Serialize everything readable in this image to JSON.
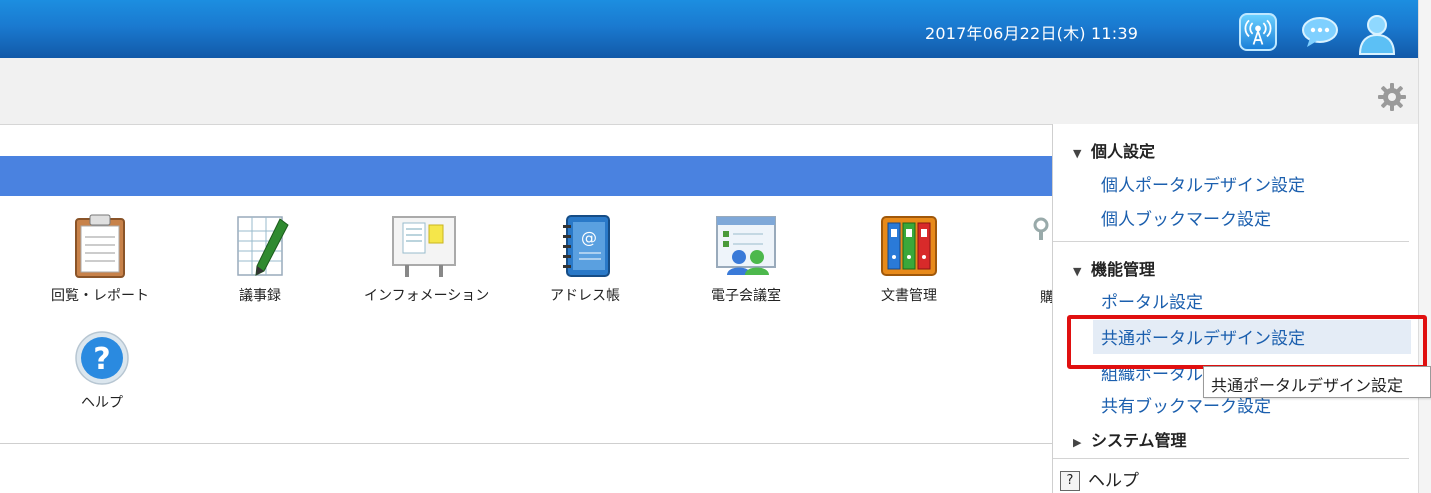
{
  "header": {
    "datetime": "2017年06月22日(木) 11:39",
    "icons": [
      "broadcast-icon",
      "chat-icon",
      "user-icon"
    ]
  },
  "toolbar": {
    "settings_icon": "gear-icon"
  },
  "apps": [
    {
      "label": "回覧・レポート",
      "icon": "clipboard-icon"
    },
    {
      "label": "議事録",
      "icon": "minutes-icon"
    },
    {
      "label": "インフォメーション",
      "icon": "bulletin-board-icon"
    },
    {
      "label": "アドレス帳",
      "icon": "address-book-icon"
    },
    {
      "label": "電子会議室",
      "icon": "conference-room-icon"
    },
    {
      "label": "文書管理",
      "icon": "binders-icon"
    },
    {
      "label": "ヘルプ",
      "icon": "help-icon"
    }
  ],
  "partial_label": "購",
  "menu": {
    "personal": {
      "title": "個人設定",
      "items": [
        "個人ポータルデザイン設定",
        "個人ブックマーク設定"
      ]
    },
    "function": {
      "title": "機能管理",
      "items": [
        "ポータル設定",
        "共通ポータルデザイン設定",
        "組織ポータル",
        "共有ブックマーク設定"
      ]
    },
    "system": {
      "title": "システム管理"
    },
    "help": {
      "label": "ヘルプ",
      "icon_text": "?"
    }
  },
  "tooltip": "共通ポータルデザイン設定"
}
